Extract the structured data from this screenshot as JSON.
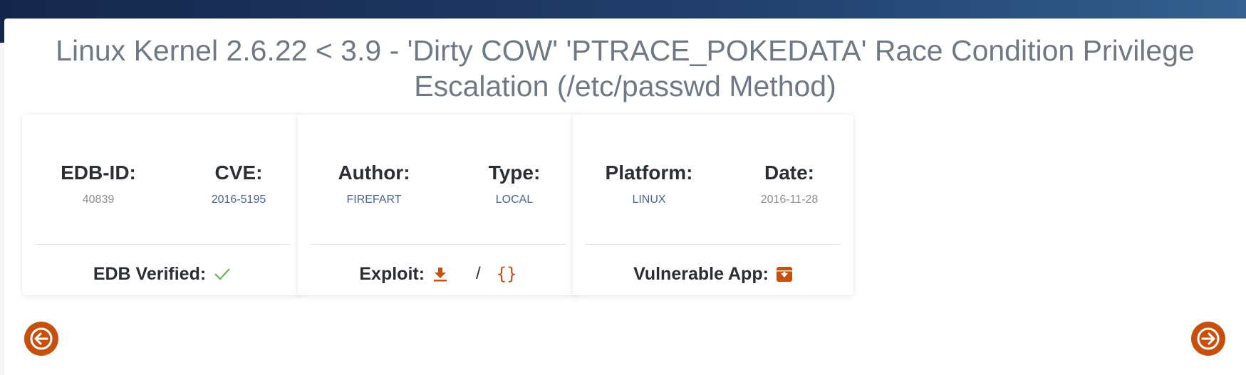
{
  "page": {
    "title": "Linux Kernel 2.6.22 < 3.9 - 'Dirty COW' 'PTRACE_POKEDATA' Race Condition Privilege Escalation (/etc/passwd Method)"
  },
  "cards": [
    {
      "left_label": "EDB-ID:",
      "left_value": "40839",
      "right_label": "CVE:",
      "right_value": "2016-5195",
      "footer_label": "EDB Verified:"
    },
    {
      "left_label": "Author:",
      "left_value": "FIREFART",
      "right_label": "Type:",
      "right_value": "LOCAL",
      "footer_label": "Exploit:",
      "footer_sep": "/",
      "footer_code": "{}"
    },
    {
      "left_label": "Platform:",
      "left_value": "LINUX",
      "right_label": "Date:",
      "right_value": "2016-11-28",
      "footer_label": "Vulnerable App:"
    }
  ],
  "icons": {
    "verified": "check-icon",
    "download": "download-icon",
    "view_code": "code-braces-icon",
    "vulnerable_app": "archive-download-icon",
    "prev": "arrow-left-icon",
    "next": "arrow-right-icon"
  },
  "colors": {
    "accent": "#c8500f",
    "verified": "#6fae5c",
    "link": "#4a6491",
    "title": "#6f7985",
    "header_start": "#15264a",
    "header_end": "#33608f"
  }
}
